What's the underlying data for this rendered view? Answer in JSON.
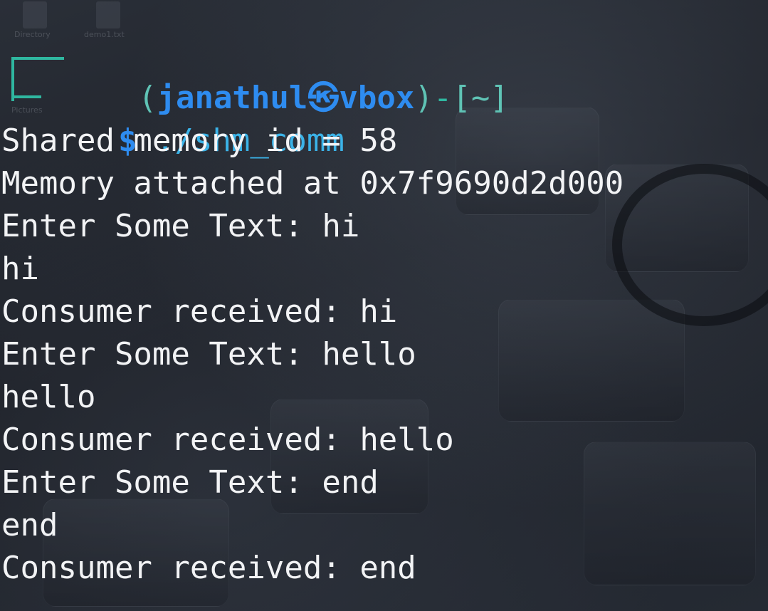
{
  "desktop": {
    "icons": [
      {
        "label": "Directory"
      },
      {
        "label": "demo1.txt"
      },
      {
        "label": "Pictures"
      }
    ]
  },
  "prompt": {
    "open_paren": "(",
    "user": "janathul",
    "at_symbol": "㉿",
    "host": "vbox",
    "close_paren": ")",
    "separator": "-",
    "dir": "[~]",
    "dollar": "$",
    "command": "./shm_comm"
  },
  "output": [
    "Shared memory id = 58",
    "Memory attached at 0x7f9690d2d000",
    "Enter Some Text: hi",
    "hi",
    "Consumer received: hi",
    "Enter Some Text: hello",
    "hello",
    "Consumer received: hello",
    "Enter Some Text: end",
    "end",
    "Consumer received: end"
  ]
}
